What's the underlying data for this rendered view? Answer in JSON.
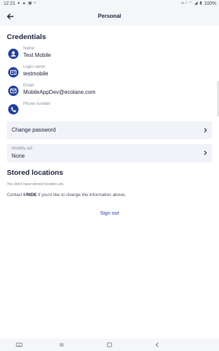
{
  "status_bar": {
    "time": "12:21",
    "battery": "100%"
  },
  "header": {
    "title": "Personal"
  },
  "credentials": {
    "title": "Credentials",
    "fields": [
      {
        "label": "Name:",
        "value": "Test Mobile",
        "icon": "person-icon"
      },
      {
        "label": "Login name:",
        "value": "testmobile",
        "icon": "id-card-icon"
      },
      {
        "label": "Email:",
        "value": "MobileAppDev@ecolane.com",
        "icon": "email-icon"
      },
      {
        "label": "Phone number:",
        "value": "",
        "icon": "phone-icon"
      }
    ]
  },
  "change_password": {
    "label": "Change password"
  },
  "mobility_aid": {
    "label": "Mobility aid",
    "value": "None"
  },
  "stored_locations": {
    "title": "Stored locations",
    "empty_text": "You don't have stored location yet."
  },
  "contact": {
    "prefix": "Contact ",
    "org": "I-RIDE",
    "suffix": " if you'd like to change the information above."
  },
  "sign_out": {
    "label": "Sign out"
  },
  "colors": {
    "accent": "#1f3fa0",
    "card_bg": "#f2f3f8",
    "bar_bg": "#f5f6fa"
  }
}
